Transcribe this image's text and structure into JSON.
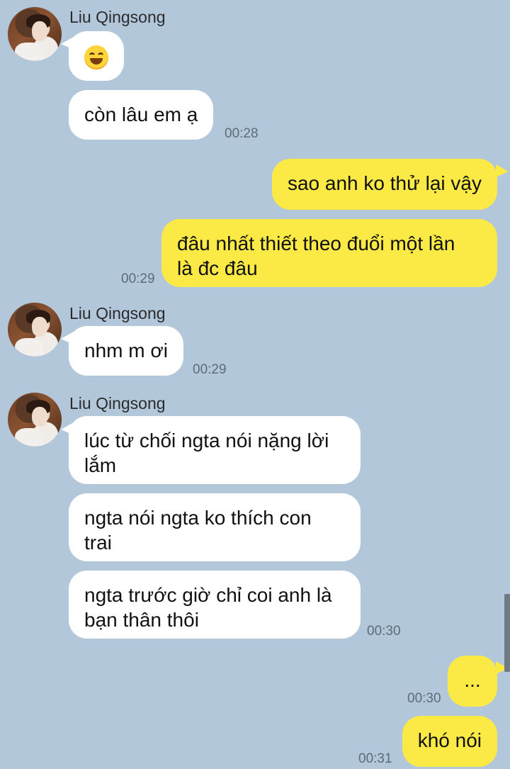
{
  "groups": [
    {
      "sender": "Liu Qingsong",
      "messages": [
        {
          "emoji": "grinning-face-emoji"
        },
        {
          "text": "còn lâu em ạ",
          "time": "00:28"
        }
      ]
    },
    {
      "outgoing": [
        {
          "text": "sao anh ko thử lại vậy"
        },
        {
          "lines": [
            "đâu nhất thiết theo đuổi một lần",
            "là đc đâu"
          ],
          "time": "00:29"
        }
      ]
    },
    {
      "sender": "Liu Qingsong",
      "messages": [
        {
          "text": "nhm m ơi",
          "time": "00:29"
        }
      ]
    },
    {
      "sender": "Liu Qingsong",
      "messages": [
        {
          "lines": [
            "lúc từ chối ngta nói nặng lời",
            "lắm"
          ]
        },
        {
          "lines": [
            "ngta nói ngta ko thích con",
            "trai"
          ]
        },
        {
          "lines": [
            "ngta trước giờ chỉ coi anh là",
            "bạn thân thôi"
          ],
          "time": "00:30"
        }
      ]
    },
    {
      "outgoing": [
        {
          "text": "...",
          "time": "00:30"
        },
        {
          "text": "khó nói",
          "time": "00:31"
        }
      ]
    }
  ],
  "colors": {
    "background": "#b3c7db",
    "incoming_bubble": "#ffffff",
    "outgoing_bubble": "#fbe945"
  }
}
